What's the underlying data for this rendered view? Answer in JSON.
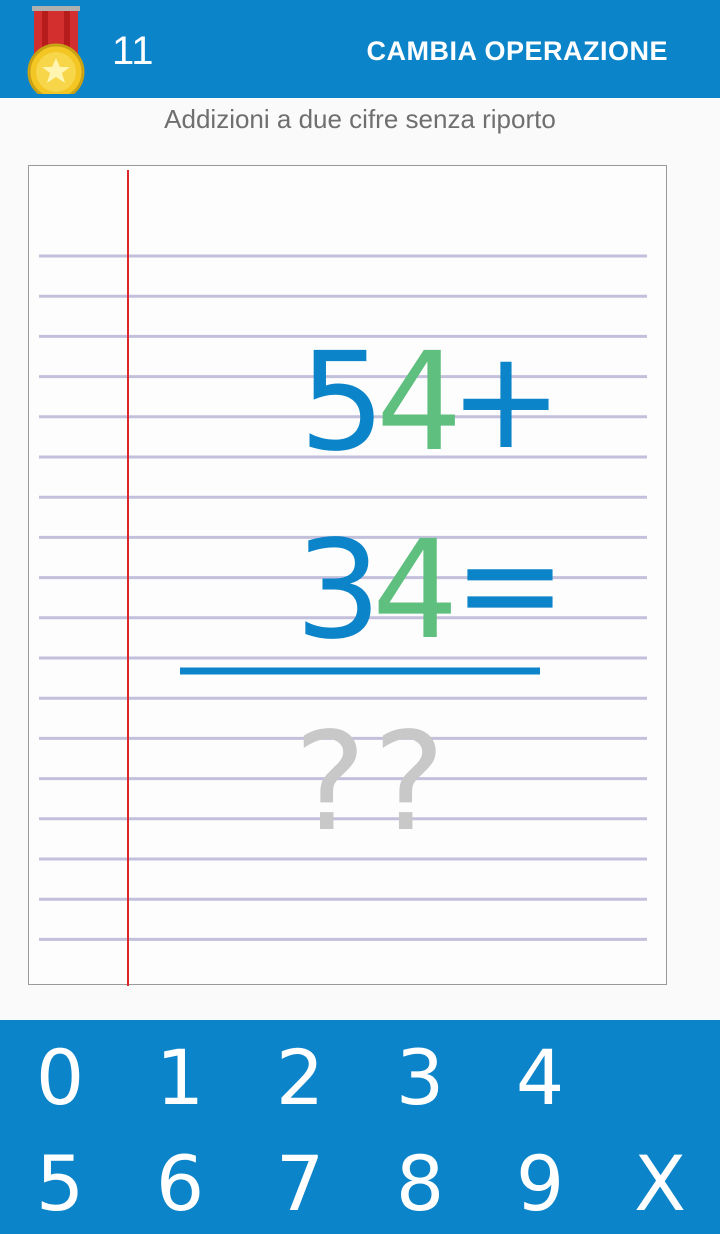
{
  "header": {
    "score": "11",
    "change_operation_label": "CAMBIA OPERAZIONE",
    "medal_icon": "medal-icon"
  },
  "subtitle": "Addizioni a due cifre senza riporto",
  "exercise": {
    "first_operand_tens": "5",
    "first_operand_units": "4",
    "plus_sign": "+",
    "second_operand_tens": "3",
    "second_operand_units": "4",
    "equals_sign": "=",
    "answer_tens": "?",
    "answer_units": "?"
  },
  "keypad": {
    "row1": [
      "0",
      "1",
      "2",
      "3",
      "4"
    ],
    "row2": [
      "5",
      "6",
      "7",
      "8",
      "9"
    ],
    "clear_label": "X"
  },
  "colors": {
    "primary": "#0b84c9",
    "units_green": "#5fbf7e",
    "placeholder_gray": "#c8c8c8",
    "margin_red": "#d9262b",
    "ruled_line": "#c3c0dc"
  }
}
